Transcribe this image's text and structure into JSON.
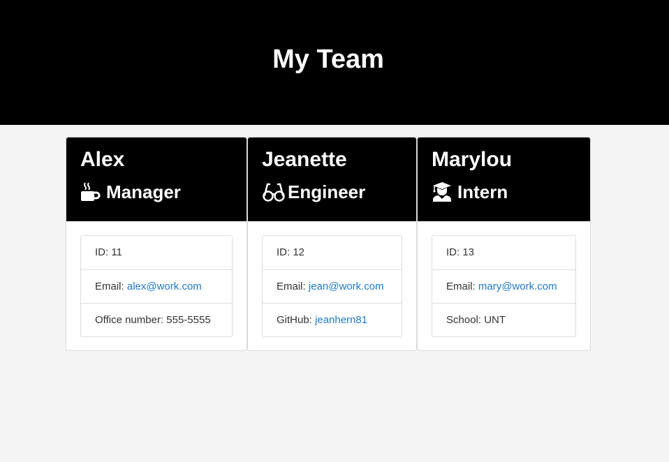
{
  "header": {
    "title": "My Team"
  },
  "cards": [
    {
      "name": "Alex",
      "role": "Manager",
      "role_icon": "mug-icon",
      "id_label": "ID:",
      "id_value": "11",
      "email_label": "Email:",
      "email_value": "alex@work.com",
      "extra_label": "Office number:",
      "extra_value": "555-5555"
    },
    {
      "name": "Jeanette",
      "role": "Engineer",
      "role_icon": "glasses-icon",
      "id_label": "ID:",
      "id_value": "12",
      "email_label": "Email:",
      "email_value": "jean@work.com",
      "extra_label": "GitHub:",
      "extra_value": "jeanhern81"
    },
    {
      "name": "Marylou",
      "role": "Intern",
      "role_icon": "graduate-icon",
      "id_label": "ID:",
      "id_value": "13",
      "email_label": "Email:",
      "email_value": "mary@work.com",
      "extra_label": "School:",
      "extra_value": "UNT"
    }
  ],
  "colors": {
    "header_bg": "#000000",
    "page_bg": "#f4f4f4",
    "link": "#1f7ac9"
  }
}
